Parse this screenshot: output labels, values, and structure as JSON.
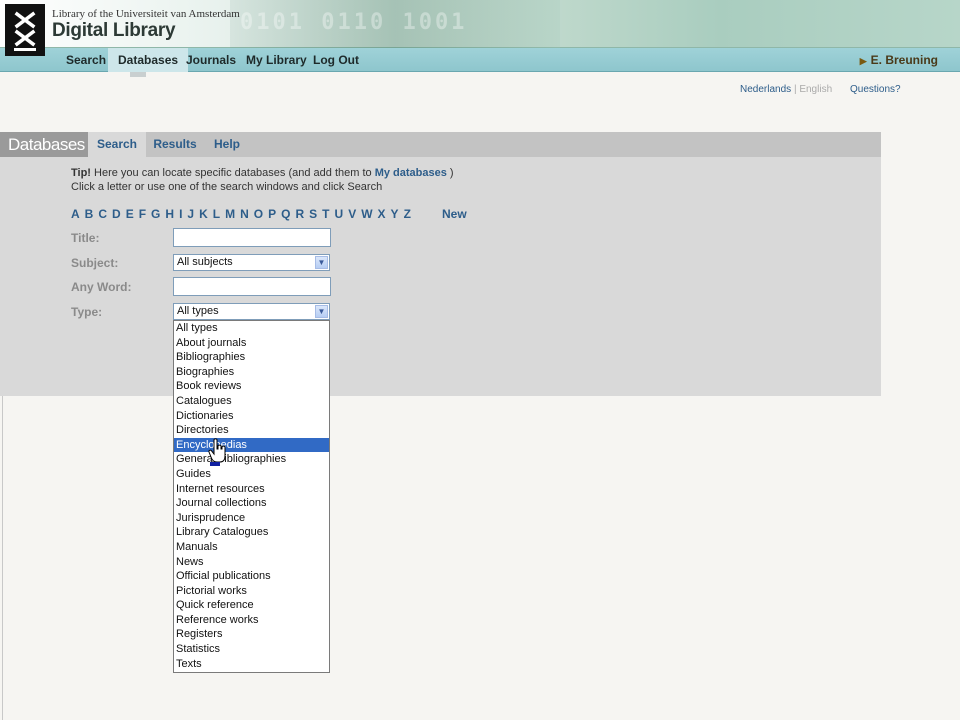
{
  "header": {
    "library_line": "Library of the Universiteit van Amsterdam",
    "title": "Digital Library",
    "deco_digits": "0101 0110 1001"
  },
  "nav": {
    "items": [
      "Search",
      "Databases",
      "Journals",
      "My Library",
      "Log Out"
    ],
    "active": "Databases",
    "user": "E. Breuning"
  },
  "lang": {
    "nederlands": "Nederlands",
    "separator": "|",
    "english": "English",
    "questions": "Questions?"
  },
  "tabs": {
    "section": "Databases",
    "items": [
      "Search",
      "Results",
      "Help"
    ],
    "active": "Search"
  },
  "tip": {
    "prefix": "Tip!",
    "text1": " Here you can locate specific databases (and add them to ",
    "link": "My databases",
    "text1_end": " )",
    "text2": "Click a letter or use one of the search windows and click Search"
  },
  "letters": [
    "A",
    "B",
    "C",
    "D",
    "E",
    "F",
    "G",
    "H",
    "I",
    "J",
    "K",
    "L",
    "M",
    "N",
    "O",
    "P",
    "Q",
    "R",
    "S",
    "T",
    "U",
    "V",
    "W",
    "X",
    "Y",
    "Z"
  ],
  "new_label": "New",
  "form": {
    "title_label": "Title:",
    "title_value": "",
    "subject_label": "Subject:",
    "subject_value": "All subjects",
    "anyword_label": "Any Word:",
    "anyword_value": "",
    "type_label": "Type:",
    "type_value": "All types"
  },
  "type_options": [
    "All types",
    "About journals",
    "Bibliographies",
    "Biographies",
    "Book reviews",
    "Catalogues",
    "Dictionaries",
    "Directories",
    "Encyclopedias",
    "General bibliographies",
    "Guides",
    "Internet resources",
    "Journal collections",
    "Jurisprudence",
    "Library Catalogues",
    "Manuals",
    "News",
    "Official publications",
    "Pictorial works",
    "Quick reference",
    "Reference works",
    "Registers",
    "Statistics",
    "Texts"
  ],
  "highlighted_option": "Encyclopedias",
  "colors": {
    "link": "#2d5d8a",
    "selected": "#316ac5",
    "nav": "#9fd2d8"
  }
}
